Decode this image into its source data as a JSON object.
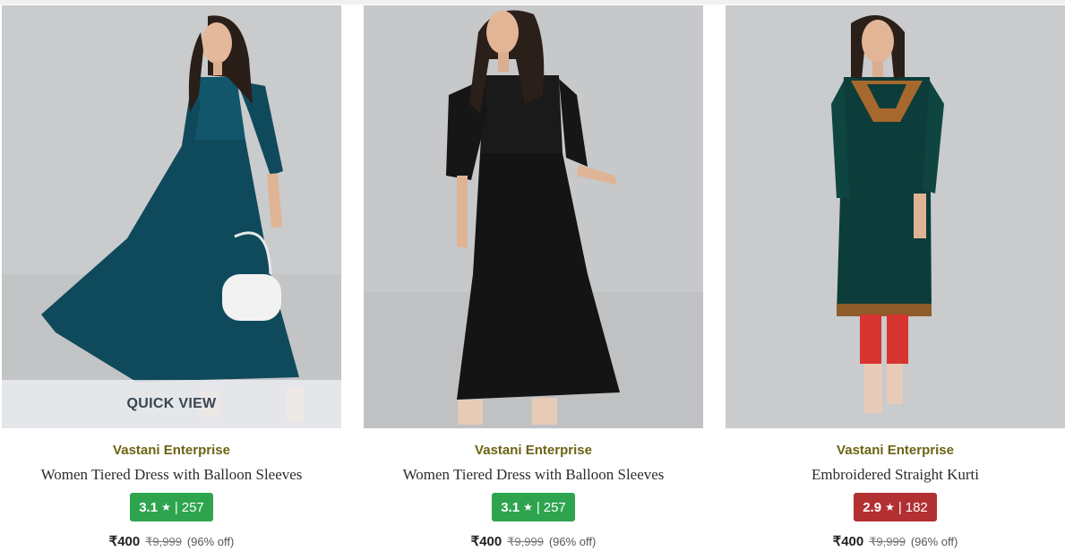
{
  "products": [
    {
      "brand": "Vastani Enterprise",
      "title": "Women Tiered Dress with Balloon Sleeves",
      "rating": "3.1",
      "reviews": "257",
      "price": "₹400",
      "mrp": "₹9,999",
      "discount": "(96% off)",
      "rating_color": "#2ea44f",
      "quick_view": "QUICK VIEW"
    },
    {
      "brand": "Vastani Enterprise",
      "title": "Women Tiered Dress with Balloon Sleeves",
      "rating": "3.1",
      "reviews": "257",
      "price": "₹400",
      "mrp": "₹9,999",
      "discount": "(96% off)",
      "rating_color": "#2ea44f"
    },
    {
      "brand": "Vastani Enterprise",
      "title": "Embroidered Straight Kurti",
      "rating": "2.9",
      "reviews": "182",
      "price": "₹400",
      "mrp": "₹9,999",
      "discount": "(96% off)",
      "rating_color": "#b22f32"
    }
  ],
  "icons": {
    "rating_star": "star-icon"
  }
}
